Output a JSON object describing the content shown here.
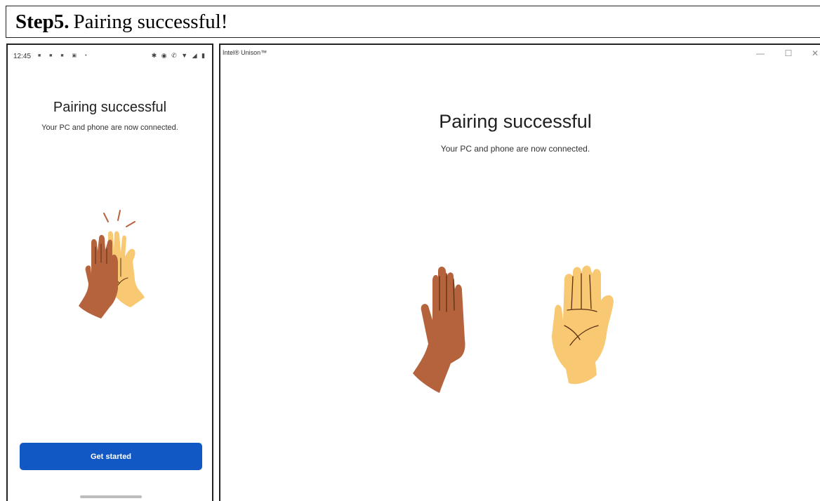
{
  "step": {
    "label": "Step5.",
    "text": "Pairing successful!"
  },
  "phone": {
    "status_time": "12:45",
    "title": "Pairing successful",
    "subtitle": "Your PC and phone are now connected.",
    "get_started_label": "Get started",
    "illustration": "high-five-hands"
  },
  "pc": {
    "app_title": "Intel® Unison™",
    "minimize_icon": "—",
    "maximize_icon": "☐",
    "close_icon": "✕",
    "title": "Pairing successful",
    "subtitle": "Your PC and phone are now connected.",
    "illustration": "two-raised-hands"
  },
  "colors": {
    "accent": "#1258c4",
    "dark_hand": "#b5633c",
    "light_hand": "#f8c872",
    "hand_line": "#5a2e12"
  }
}
